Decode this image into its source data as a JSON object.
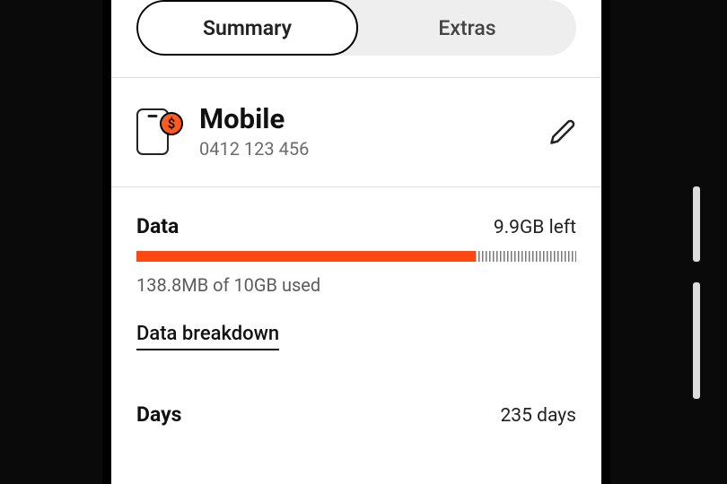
{
  "tabs": {
    "summary": "Summary",
    "extras": "Extras"
  },
  "account": {
    "title": "Mobile",
    "number": "0412 123 456",
    "badge": "$"
  },
  "data": {
    "label": "Data",
    "remaining": "9.9GB left",
    "used_text": "138.8MB of 10GB used",
    "breakdown_link": "Data breakdown",
    "progress_percent": 77
  },
  "days": {
    "label": "Days",
    "value": "235 days"
  },
  "colors": {
    "accent": "#ff4713"
  }
}
